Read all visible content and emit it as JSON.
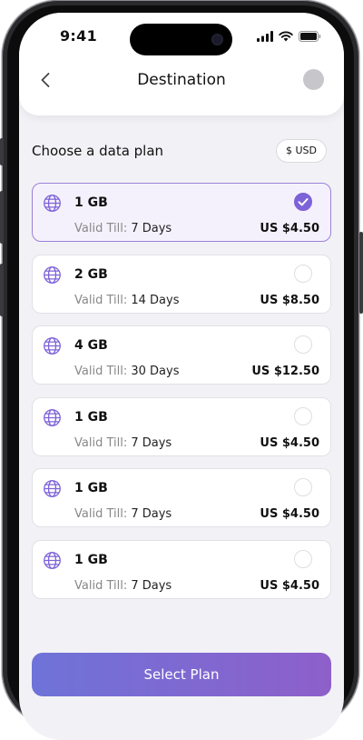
{
  "status_bar": {
    "time": "9:41"
  },
  "header": {
    "title": "Destination"
  },
  "section": {
    "label": "Choose a data plan",
    "currency": "$ USD"
  },
  "plans": [
    {
      "data": "1 GB",
      "valid_label": "Valid Till:",
      "valid_value": "7 Days",
      "price": "US $4.50",
      "selected": true
    },
    {
      "data": "2 GB",
      "valid_label": "Valid Till:",
      "valid_value": "14 Days",
      "price": "US $8.50",
      "selected": false
    },
    {
      "data": "4 GB",
      "valid_label": "Valid Till:",
      "valid_value": "30 Days",
      "price": "US $12.50",
      "selected": false
    },
    {
      "data": "1 GB",
      "valid_label": "Valid Till:",
      "valid_value": "7 Days",
      "price": "US $4.50",
      "selected": false
    },
    {
      "data": "1 GB",
      "valid_label": "Valid Till:",
      "valid_value": "7 Days",
      "price": "US $4.50",
      "selected": false
    },
    {
      "data": "1 GB",
      "valid_label": "Valid Till:",
      "valid_value": "7 Days",
      "price": "US $4.50",
      "selected": false
    }
  ],
  "cta": {
    "label": "Select Plan"
  },
  "colors": {
    "accent": "#7d62d8",
    "selected_bg": "#f5f1fc",
    "gradient_start": "#6e73d8",
    "gradient_end": "#8e5fca"
  },
  "icons": {
    "back": "chevron-left-icon",
    "plan": "globe-icon",
    "selected": "check-icon"
  }
}
